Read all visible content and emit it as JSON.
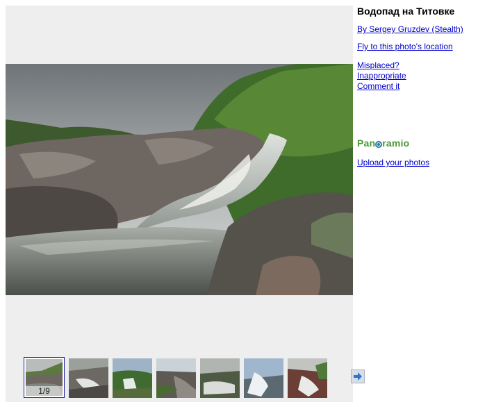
{
  "photo": {
    "title": "Водопад на Титовке",
    "author_link": "By Sergey Gruzdev (Stealth)",
    "fly_link": "Fly to this photo's location"
  },
  "report": {
    "misplaced": "Misplaced?",
    "inappropriate": "Inappropriate",
    "comment": "Comment it"
  },
  "brand": {
    "logo_text_left": "Pan",
    "logo_text_right": "ramio",
    "upload_link": "Upload your photos"
  },
  "thumbnails": {
    "counter": "1/9",
    "items": [
      {
        "id": "thumb-1",
        "selected": true
      },
      {
        "id": "thumb-2",
        "selected": false
      },
      {
        "id": "thumb-3",
        "selected": false
      },
      {
        "id": "thumb-4",
        "selected": false
      },
      {
        "id": "thumb-5",
        "selected": false
      },
      {
        "id": "thumb-6",
        "selected": false
      },
      {
        "id": "thumb-7",
        "selected": false
      }
    ],
    "next_icon": "arrow-right-icon"
  },
  "colors": {
    "link": "#0000cc",
    "viewer_bg": "#eeeeee",
    "logo_green": "#4a9a3a",
    "logo_blue": "#1f7fa8"
  }
}
